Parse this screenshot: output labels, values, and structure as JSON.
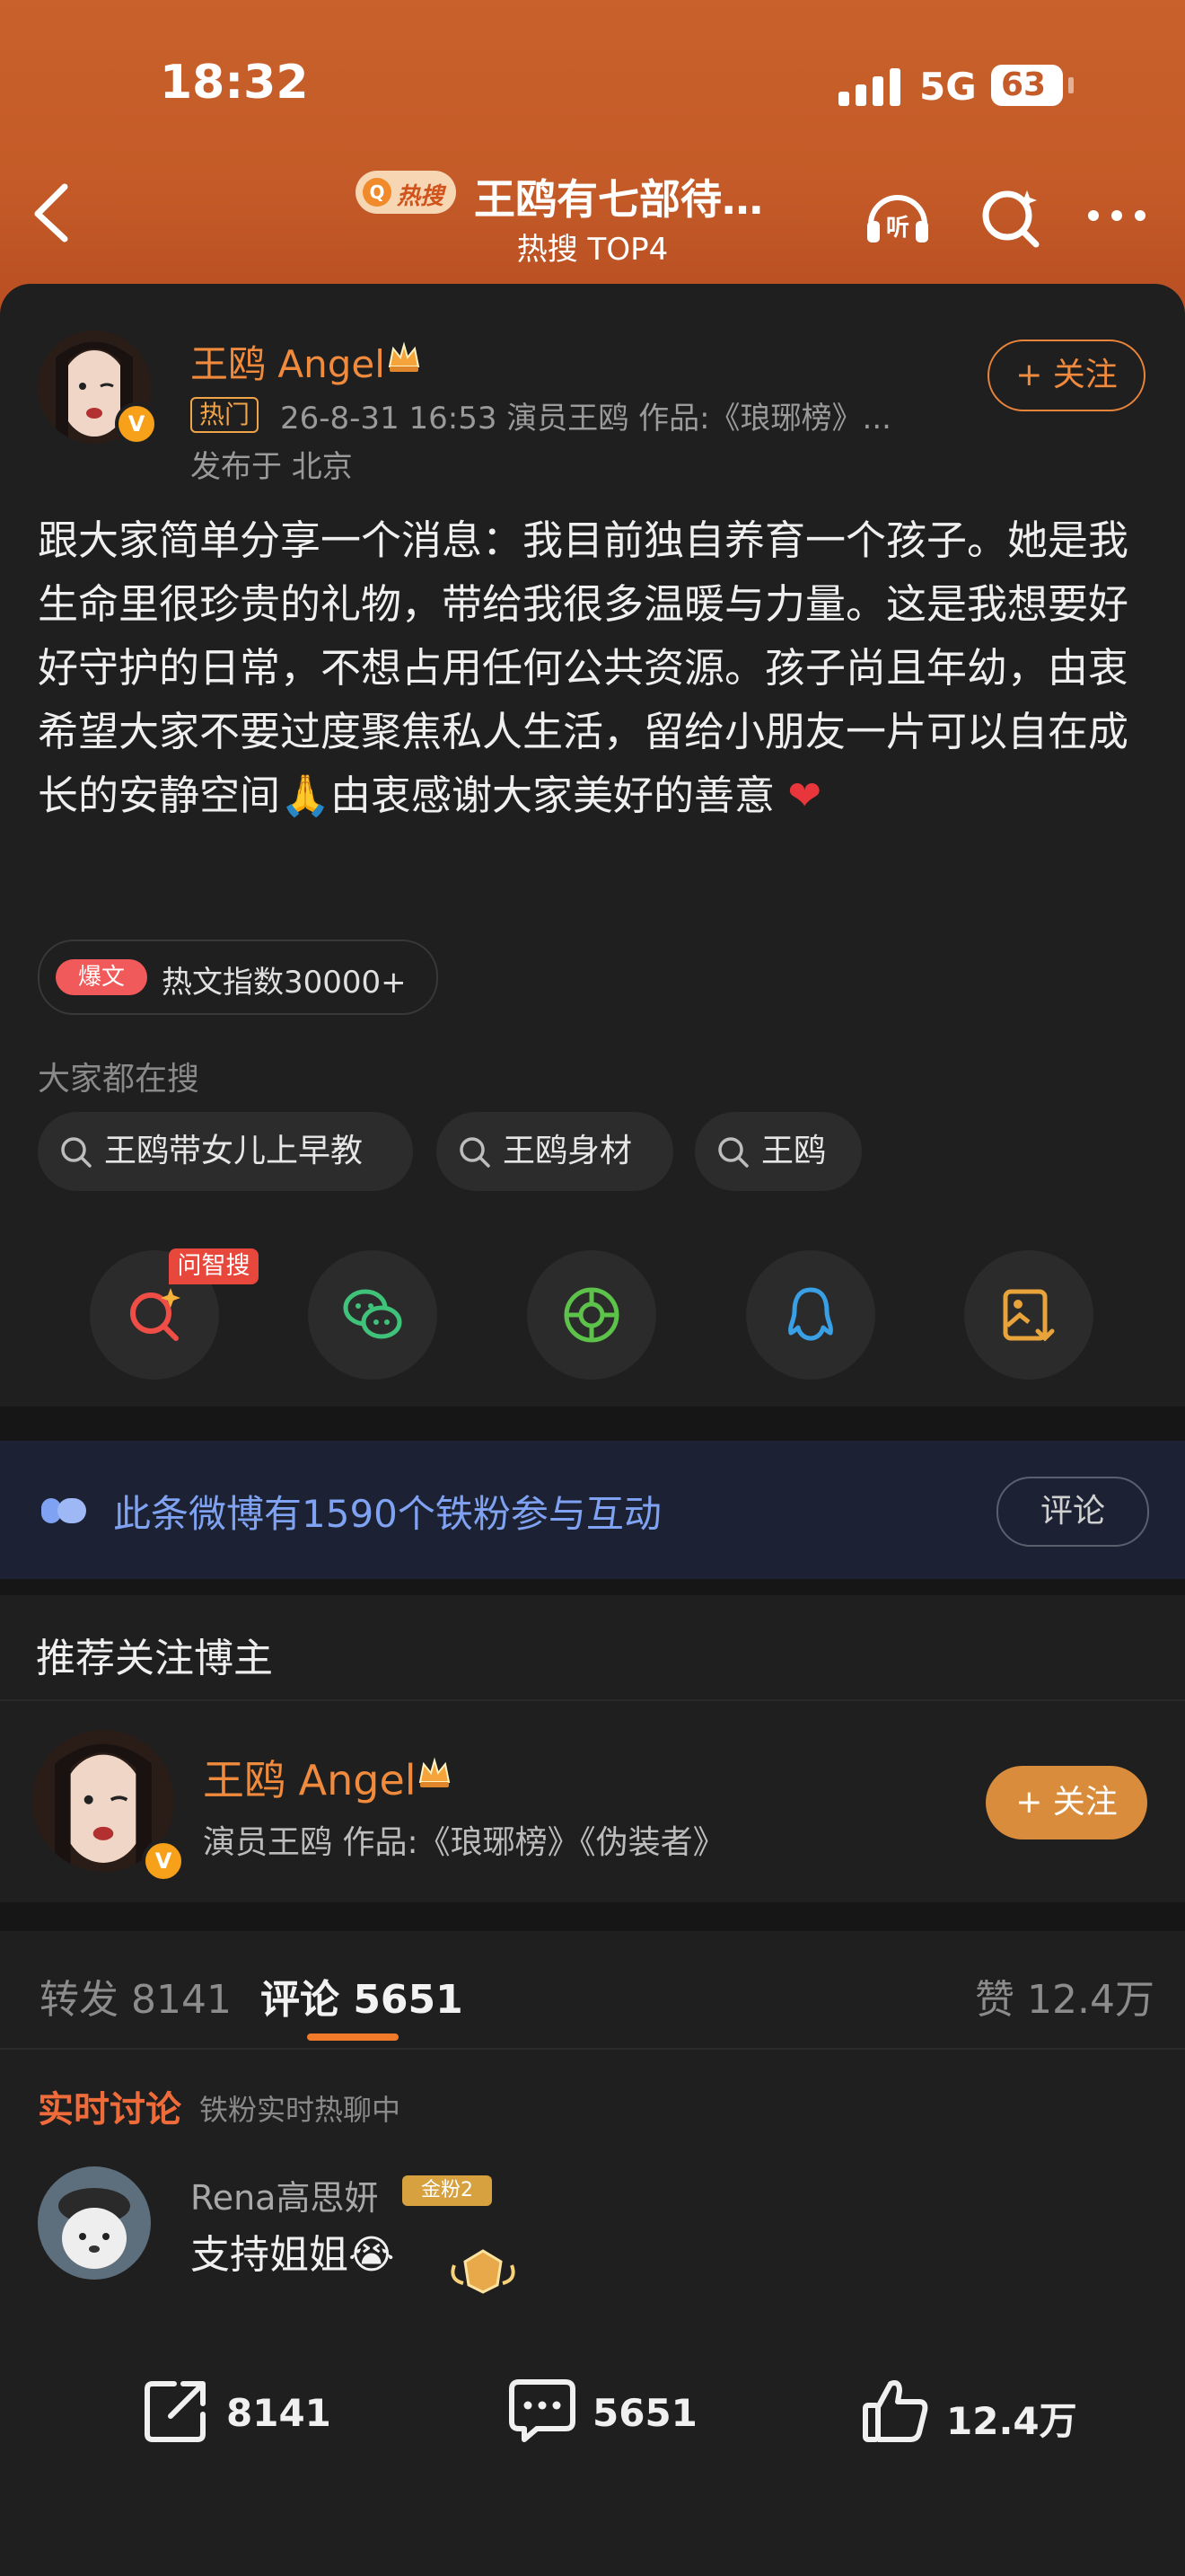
{
  "status_bar": {
    "time": "18:32",
    "network": "5G",
    "battery": "63"
  },
  "nav": {
    "hot_label": "热搜",
    "title": "王鸥有七部待…",
    "subtitle": "热搜 TOP4"
  },
  "post": {
    "author": "王鸥 Angel",
    "hot_tag": "热门",
    "meta": "26-8-31 16:53  演员王鸥 作品:《琅琊榜》...",
    "location": "发布于 北京",
    "follow_label": "+ 关注",
    "text": "跟大家简单分享一个消息：我目前独自养育一个孩子。她是我生命里很珍贵的礼物，带给我很多温暖与力量。这是我想要好好守护的日常，不想占用任何公共资源。孩子尚且年幼，由衷希望大家不要过度聚焦私人生活，留给小朋友一片可以自在成长的安静空间🙏由衷感谢大家美好的善意",
    "heart": "❤",
    "hot_index_badge": "爆文",
    "hot_index_text": "热文指数30000+"
  },
  "search": {
    "heading": "大家都在搜",
    "chips": [
      "王鸥带女儿上早教",
      "王鸥身材",
      "王鸥"
    ]
  },
  "share": {
    "badge": "问智搜"
  },
  "fans_banner": {
    "text": "此条微博有1590个铁粉参与互动",
    "button": "评论"
  },
  "recommend": {
    "title": "推荐关注博主",
    "name": "王鸥 Angel",
    "desc": "演员王鸥 作品:《琅琊榜》《伪装者》",
    "follow_label": "+ 关注"
  },
  "tabs": {
    "repost": "转发 8141",
    "comment": "评论 5651",
    "likes": "赞 12.4万"
  },
  "realtime": {
    "title": "实时讨论",
    "subtitle": "铁粉实时热聊中"
  },
  "comment": {
    "user": "Rena高思妍",
    "badge": "金粉2",
    "text": "支持姐姐",
    "emoji": "😭"
  },
  "bottom_bar": {
    "repost": "8141",
    "comment": "5651",
    "like": "12.4万"
  },
  "colors": {
    "accent": "#f08a3c",
    "header": "#c45b28",
    "link": "#7fa3f2"
  }
}
